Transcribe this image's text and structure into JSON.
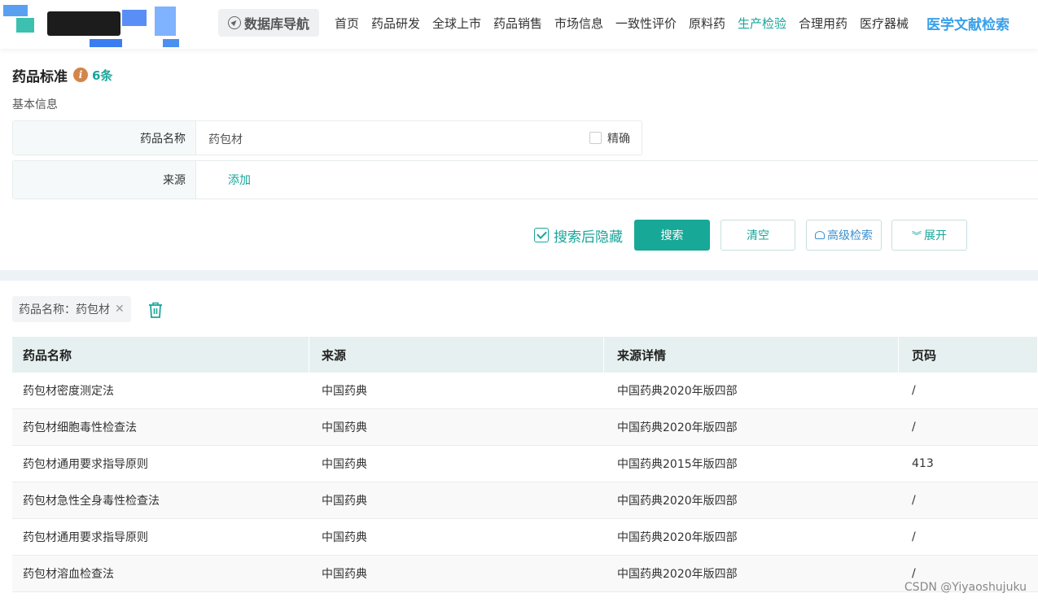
{
  "header": {
    "db_nav_label": "数据库导航",
    "nav_items": [
      "首页",
      "药品研发",
      "全球上市",
      "药品销售",
      "市场信息",
      "一致性评价",
      "原料药",
      "生产检验",
      "合理用药",
      "医疗器械"
    ],
    "active_nav": "生产检验",
    "literature_search": "医学文献检索"
  },
  "page": {
    "title": "药品标准",
    "count": "6条",
    "section_label": "基本信息"
  },
  "form": {
    "drug_name_label": "药品名称",
    "drug_name_value": "药包材",
    "exact_label": "精确",
    "exact_checked": false,
    "source_label": "来源",
    "source_add": "添加"
  },
  "actions": {
    "hide_after_search_label": "搜索后隐藏",
    "hide_after_search_checked": true,
    "search": "搜索",
    "clear": "清空",
    "advanced": "高级检索",
    "expand": "展开"
  },
  "filter_chip": "药品名称：药包材",
  "table": {
    "headers": [
      "药品名称",
      "来源",
      "来源详情",
      "页码"
    ],
    "rows": [
      [
        "药包材密度测定法",
        "中国药典",
        "中国药典2020年版四部",
        "/"
      ],
      [
        "药包材细胞毒性检查法",
        "中国药典",
        "中国药典2020年版四部",
        "/"
      ],
      [
        "药包材通用要求指导原则",
        "中国药典",
        "中国药典2015年版四部",
        "413"
      ],
      [
        "药包材急性全身毒性检查法",
        "中国药典",
        "中国药典2020年版四部",
        "/"
      ],
      [
        "药包材通用要求指导原则",
        "中国药典",
        "中国药典2020年版四部",
        "/"
      ],
      [
        "药包材溶血检查法",
        "中国药典",
        "中国药典2020年版四部",
        "/"
      ]
    ]
  },
  "watermark": "CSDN @Yiyaoshujuku",
  "colors": {
    "accent": "#17a898",
    "link_blue": "#3aa0e8",
    "info_orange": "#d3864a"
  }
}
